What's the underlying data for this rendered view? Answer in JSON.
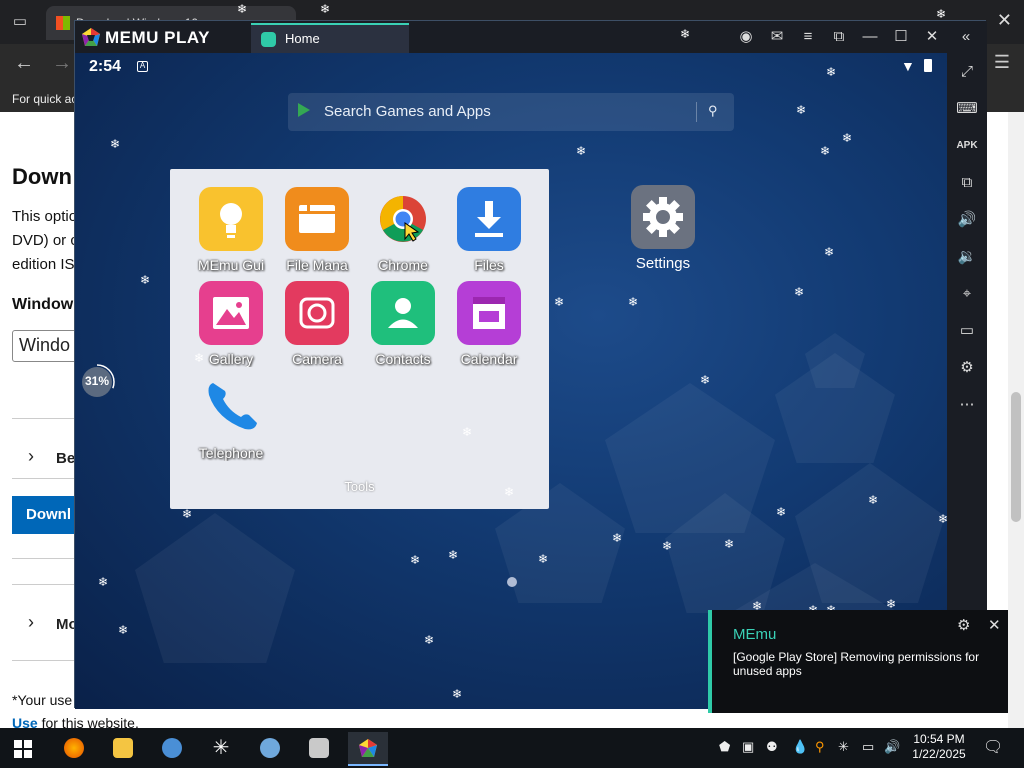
{
  "browser": {
    "tab_title": "Download Windows 10",
    "fav_hint": "For quick ac",
    "heading": "Down",
    "para": [
      "This optio",
      "DVD) or c",
      "edition IS"
    ],
    "windows_label": "Window",
    "select_value": "Windo",
    "expander1": "Be",
    "download_btn": "Downl",
    "expander2": "Mo",
    "footer1": "*Your use",
    "footer2_link": "Use",
    "footer2_rest": " for this website."
  },
  "memu": {
    "brand": "MEMU PLAY",
    "tab_label": "Home",
    "time": "2:54",
    "search_placeholder": "Search Games and Apps",
    "folder": {
      "name": "Tools",
      "apps": [
        {
          "label": "MEmu Gui",
          "color": "#f9c22e",
          "icon": "lightbulb-icon"
        },
        {
          "label": "File Mana",
          "color": "#f08c1c",
          "icon": "folder-icon"
        },
        {
          "label": "Chrome",
          "color": "#ffffff",
          "icon": "chrome-icon"
        },
        {
          "label": "Files",
          "color": "#2f7de1",
          "icon": "download-icon"
        },
        {
          "label": "Gallery",
          "color": "#e63f8e",
          "icon": "picture-icon"
        },
        {
          "label": "Camera",
          "color": "#e33a5f",
          "icon": "camera-icon"
        },
        {
          "label": "Contacts",
          "color": "#1fbf7c",
          "icon": "contacts-icon"
        },
        {
          "label": "Calendar",
          "color": "#b53ed6",
          "icon": "calendar-icon"
        },
        {
          "label": "Telephone",
          "color": "#1e88e5",
          "icon": "phone-icon"
        }
      ]
    },
    "settings_label": "Settings",
    "progress": "31%",
    "toast": {
      "title": "MEmu",
      "body": "[Google Play Store] Removing permissions for unused apps"
    }
  },
  "taskbar": {
    "time": "10:54 PM",
    "date": "1/22/2025"
  }
}
